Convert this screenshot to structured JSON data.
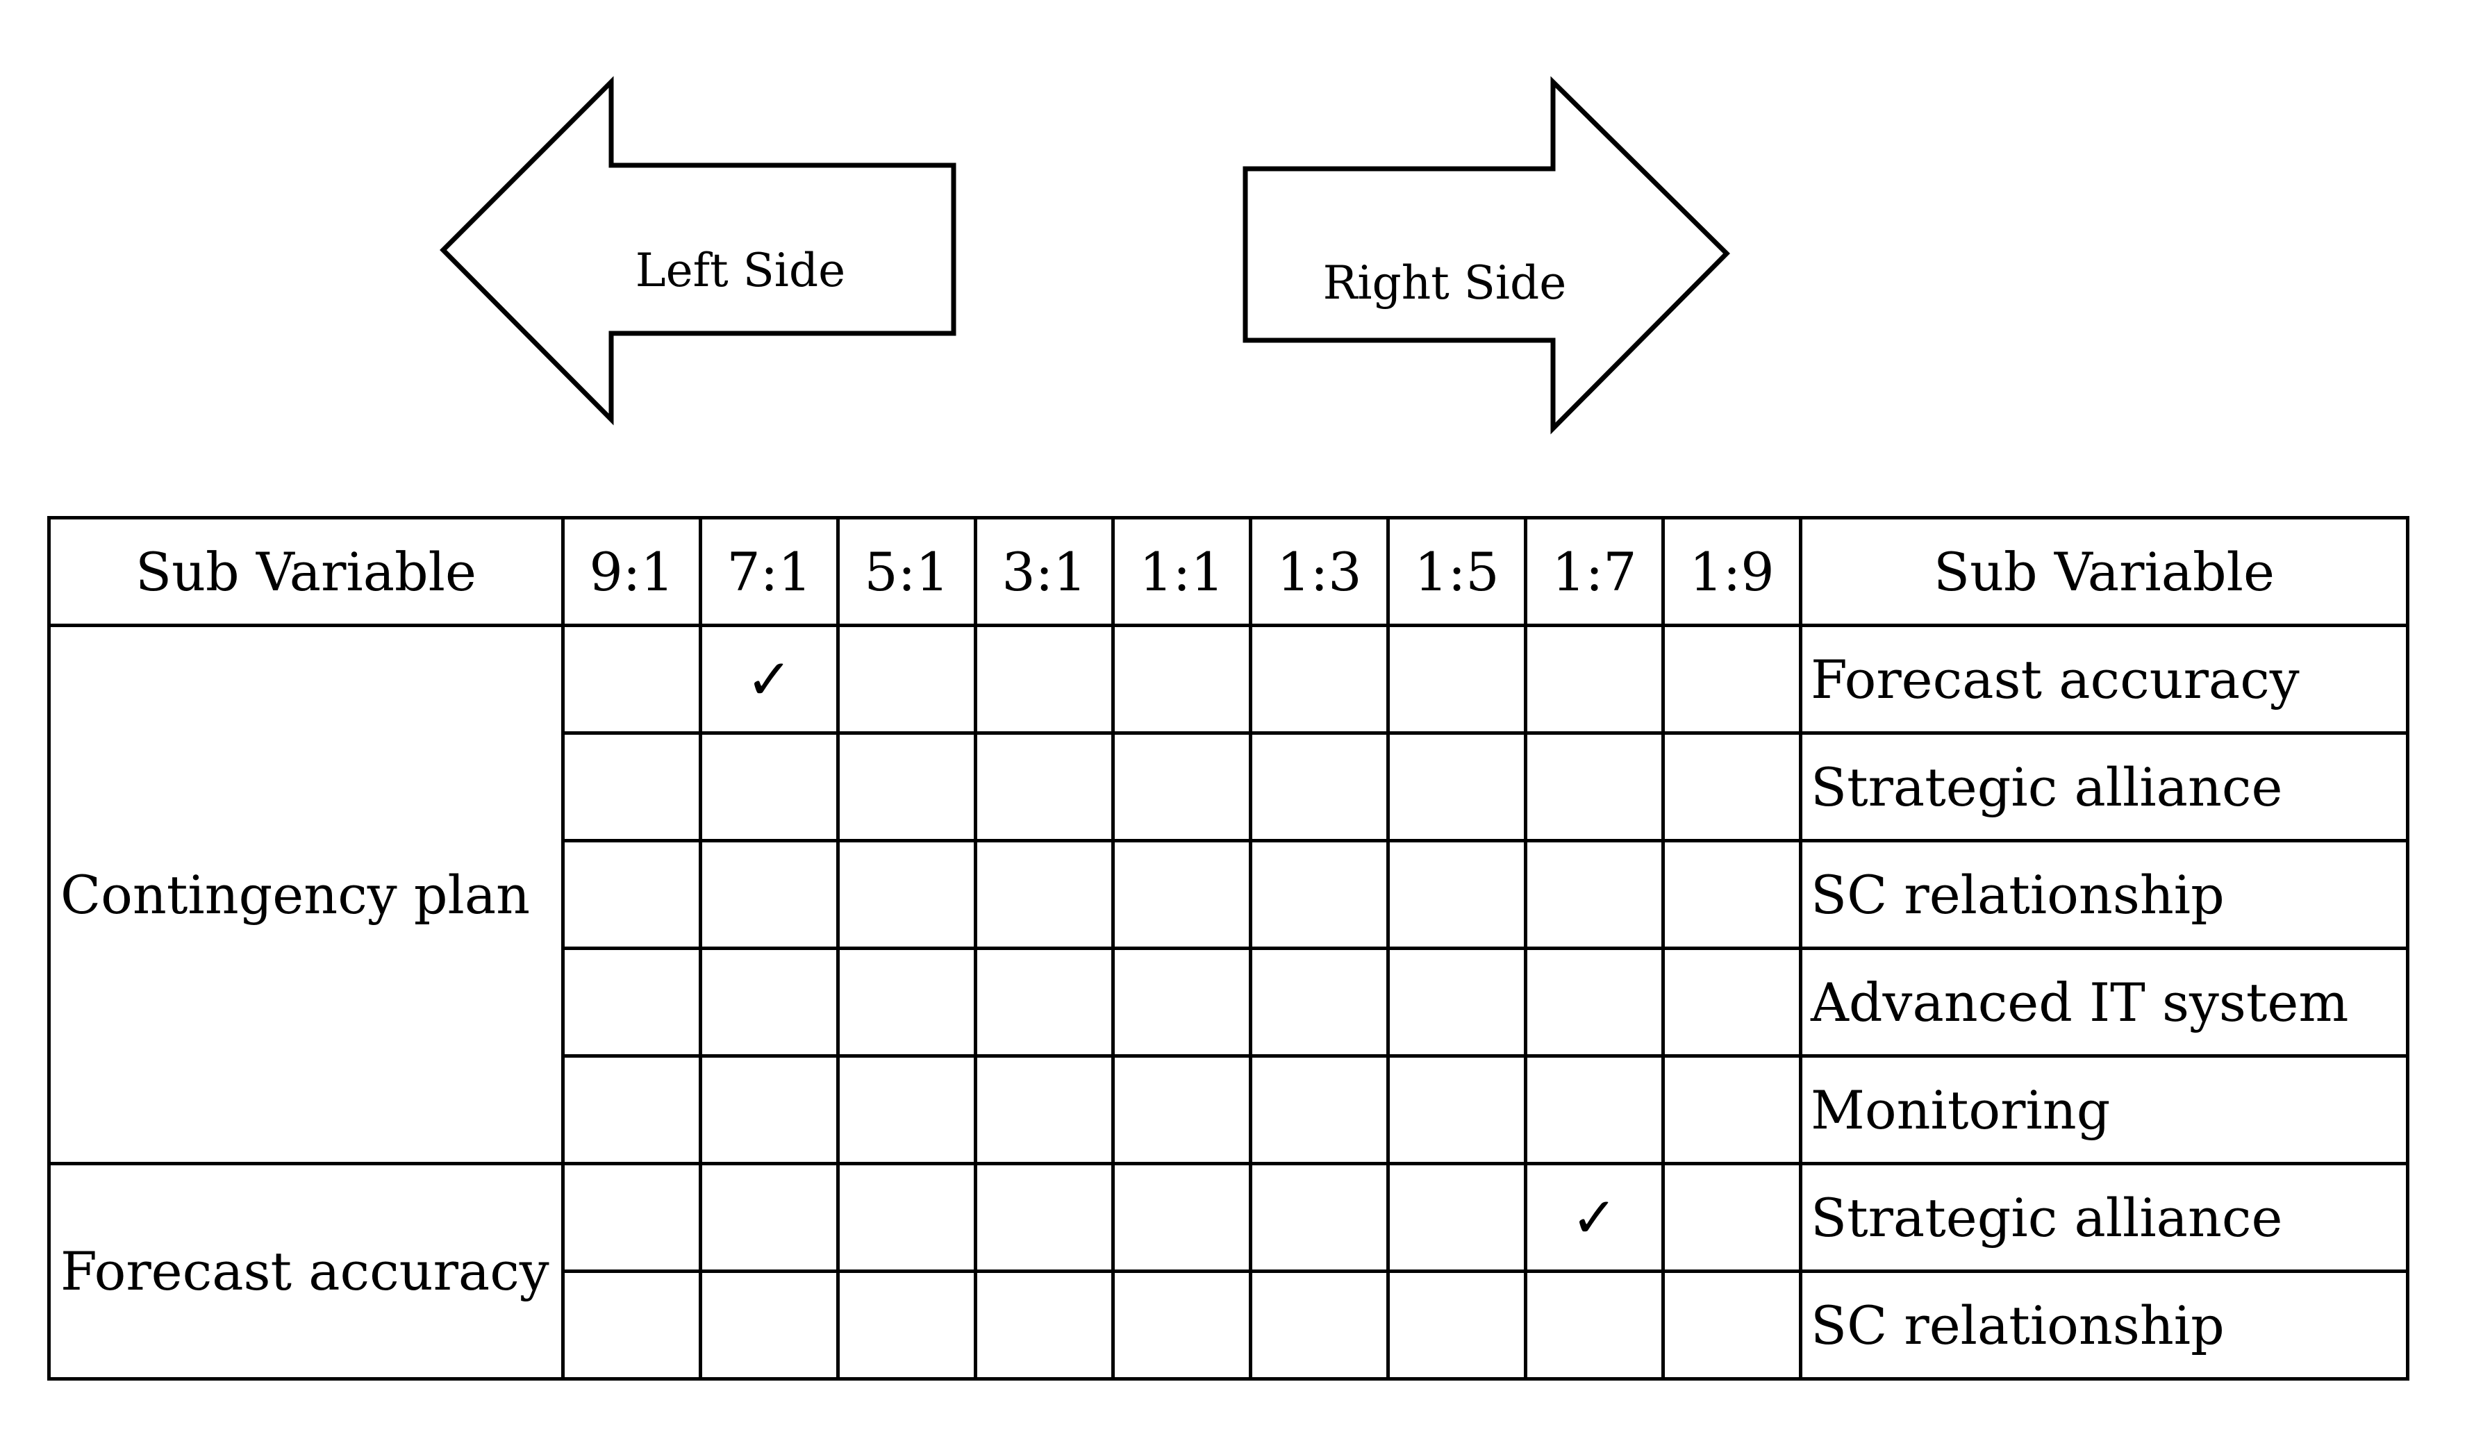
{
  "arrows": {
    "left_label": "Left Side",
    "right_label": "Right Side"
  },
  "table": {
    "header": {
      "left": "Sub Variable",
      "ratios": [
        "9:1",
        "7:1",
        "5:1",
        "3:1",
        "1:1",
        "1:3",
        "1:5",
        "1:7",
        "1:9"
      ],
      "right": "Sub Variable"
    },
    "groups": [
      {
        "left_variable": "Contingency plan",
        "rows": [
          {
            "right_variable": "Forecast accuracy",
            "checked_ratio": "7:1"
          },
          {
            "right_variable": "Strategic alliance",
            "checked_ratio": null
          },
          {
            "right_variable": "SC relationship",
            "checked_ratio": null
          },
          {
            "right_variable": "Advanced IT system",
            "checked_ratio": null
          },
          {
            "right_variable": "Monitoring",
            "checked_ratio": null
          }
        ]
      },
      {
        "left_variable": "Forecast accuracy",
        "rows": [
          {
            "right_variable": "Strategic alliance",
            "checked_ratio": "1:7"
          },
          {
            "right_variable": "SC relationship",
            "checked_ratio": null
          }
        ]
      }
    ],
    "check_mark": "✓"
  }
}
